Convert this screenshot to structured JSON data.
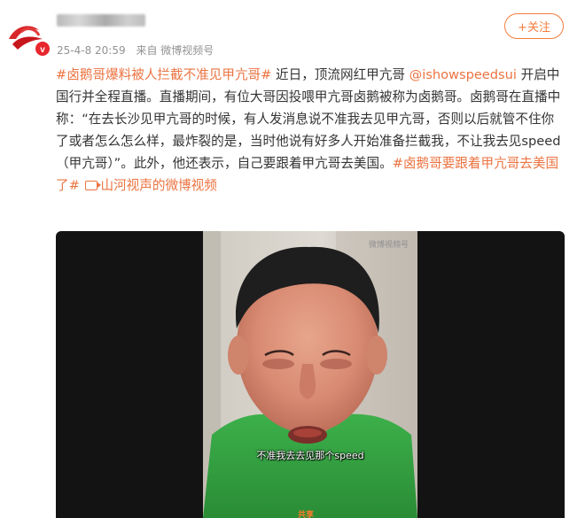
{
  "post": {
    "timestamp": "25-4-8 20:59",
    "source": "来自 微博视频号",
    "follow_label": "+关注",
    "text": {
      "topic1": "#卤鹅哥爆料被人拦截不准见甲亢哥#",
      "part1": " 近日，顶流网红甲亢哥",
      "mention": "@ishowspeedsui",
      "part2": " 开启中国行并全程直播。直播期间，有位大哥因投喂甲亢哥卤鹅被称为卤鹅哥。卤鹅哥在直播中称：“在去长沙见甲亢哥的时候，有人发消息说不准我去见甲亢哥，否则以后就管不住你了或者怎么怎么样，最炸裂的是，当时他说有好多人开始准备拦截我，不让我去见speed（甲亢哥）”。此外，他还表示，自己要跟着甲亢哥去美国。",
      "topic2": "#卤鹅哥要跟着甲亢哥去美国了#",
      "video_link": "山河视声的微博视频"
    }
  },
  "video": {
    "watermark": "微博视频号",
    "subtitle": "不准我去去见那个speed",
    "bottom_tag": "共享"
  },
  "colors": {
    "accent": "#eb7340",
    "text": "#333333",
    "meta": "#939393",
    "video_bg": "#131313"
  },
  "icons": [
    "weibo-avatar-logo",
    "video-link-icon"
  ]
}
